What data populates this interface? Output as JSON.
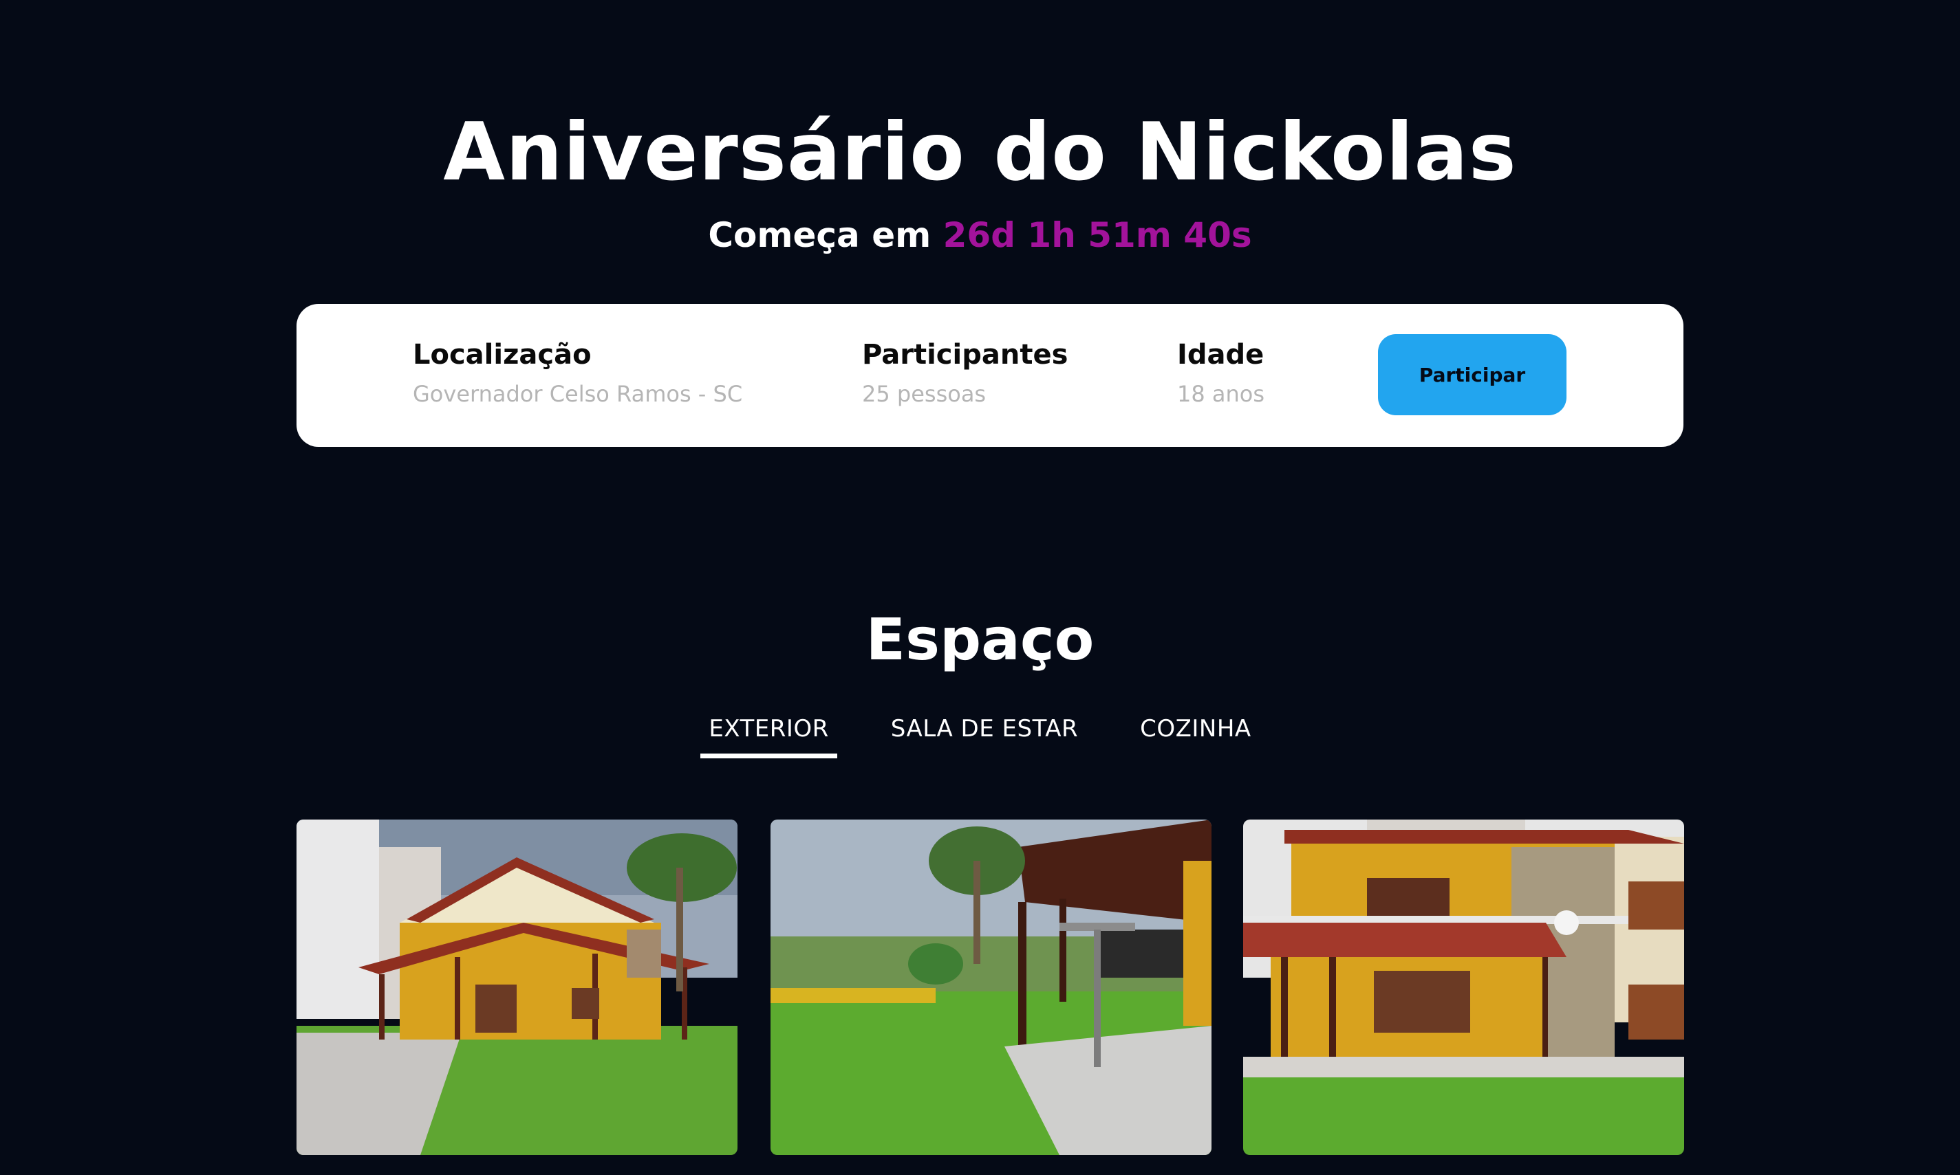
{
  "event": {
    "title": "Aniversário do Nickolas",
    "starts_prefix": "Começa em",
    "countdown": "26d 1h 51m 40s"
  },
  "info": {
    "location_label": "Localização",
    "location_value": "Governador Celso Ramos - SC",
    "participants_label": "Participantes",
    "participants_value": "25 pessoas",
    "age_label": "Idade",
    "age_value": "18 anos",
    "join_label": "Participar"
  },
  "space": {
    "title": "Espaço",
    "tabs": [
      {
        "label": "EXTERIOR",
        "active": true
      },
      {
        "label": "SALA DE ESTAR",
        "active": false
      },
      {
        "label": "COZINHA",
        "active": false
      }
    ]
  },
  "colors": {
    "background": "#050a16",
    "accent_countdown": "#a3139b",
    "button": "#22a5ef"
  }
}
